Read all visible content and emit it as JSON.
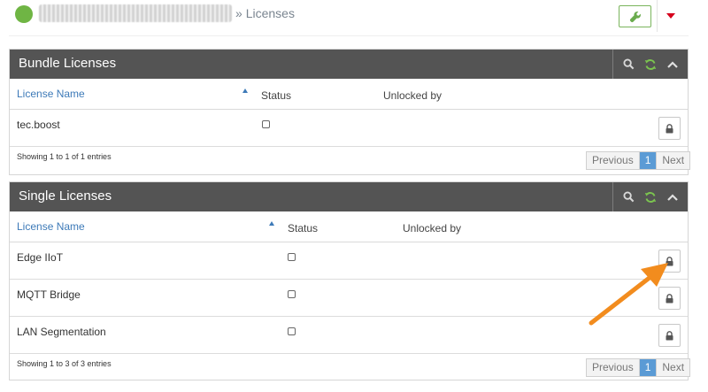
{
  "header": {
    "breadcrumb_sep": "»",
    "breadcrumb_current": "Licenses",
    "status_color": "#6fb544"
  },
  "toolbar": {
    "settings_icon": "wrench-icon",
    "menu_icon": "caret-down-icon",
    "accent_color": "#d6001c"
  },
  "bundle": {
    "title": "Bundle Licenses",
    "columns": {
      "name": "License Name",
      "status": "Status",
      "unlocked": "Unlocked by"
    },
    "rows": [
      {
        "name": "tec.boost",
        "status_checked": false,
        "unlocked_by": ""
      }
    ],
    "showing": "Showing 1 to 1 of 1 entries",
    "pager": {
      "prev": "Previous",
      "page": "1",
      "next": "Next"
    }
  },
  "single": {
    "title": "Single Licenses",
    "columns": {
      "name": "License Name",
      "status": "Status",
      "unlocked": "Unlocked by"
    },
    "rows": [
      {
        "name": "Edge IIoT",
        "status_checked": false,
        "unlocked_by": ""
      },
      {
        "name": "MQTT Bridge",
        "status_checked": false,
        "unlocked_by": ""
      },
      {
        "name": "LAN Segmentation",
        "status_checked": false,
        "unlocked_by": ""
      }
    ],
    "showing": "Showing 1 to 3 of 3 entries",
    "pager": {
      "prev": "Previous",
      "page": "1",
      "next": "Next"
    }
  },
  "panel_tools": {
    "icons": [
      "search-icon",
      "refresh-icon",
      "collapse-icon"
    ],
    "refresh_color": "#6fb544"
  },
  "annotation": {
    "color": "#f28c1e",
    "points_to": "single.rows.0 lock button"
  }
}
